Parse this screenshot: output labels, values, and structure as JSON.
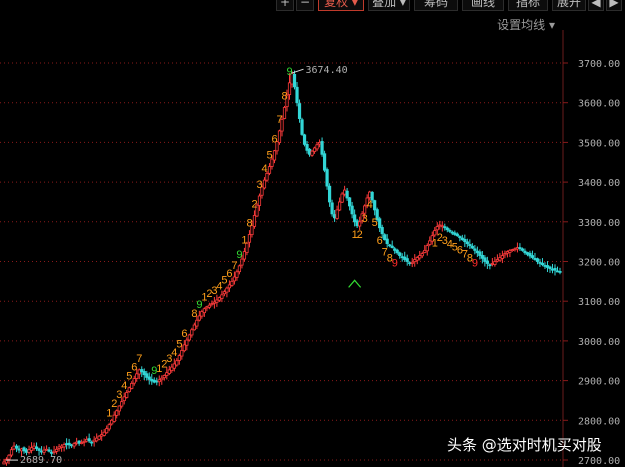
{
  "toolbar": {
    "buttons": [
      {
        "label": "+",
        "active": false
      },
      {
        "label": "−",
        "active": false
      },
      {
        "label": "复权 ▾",
        "active": true
      },
      {
        "label": "叠加 ▾",
        "active": false
      },
      {
        "label": "筹码",
        "active": false
      },
      {
        "label": "画线",
        "active": false
      },
      {
        "label": "指标",
        "active": false
      },
      {
        "label": "展开",
        "active": false
      },
      {
        "label": "◀",
        "active": false
      },
      {
        "label": "▶",
        "active": false
      }
    ]
  },
  "ma_settings_label": "设置均线 ▾",
  "watermark": "头条 @选对时机买对股",
  "colors": {
    "up": "#ff3b3b",
    "down": "#33d6d6",
    "grid": "#8a1a1a",
    "seq_orange": "#ff9f1a",
    "seq_green": "#33dd33",
    "seq_red": "#ff2a2a"
  },
  "chart_data": {
    "type": "candlestick",
    "ylim": [
      2700,
      3750
    ],
    "y_ticks": [
      "3700.00",
      "3600.00",
      "3500.00",
      "3400.00",
      "3300.00",
      "3200.00",
      "3100.00",
      "3000.00",
      "2900.00",
      "2800.00",
      "2700.00"
    ],
    "high_label": "3674.40",
    "low_label": "2689.70",
    "closes": [
      2695,
      2702,
      2712,
      2726,
      2735,
      2730,
      2725,
      2728,
      2723,
      2719,
      2726,
      2731,
      2735,
      2729,
      2724,
      2721,
      2725,
      2727,
      2722,
      2718,
      2722,
      2727,
      2733,
      2735,
      2739,
      2740,
      2738,
      2736,
      2741,
      2745,
      2742,
      2744,
      2747,
      2752,
      2748,
      2745,
      2750,
      2755,
      2760,
      2764,
      2770,
      2779,
      2789,
      2800,
      2813,
      2824,
      2836,
      2847,
      2859,
      2870,
      2882,
      2893,
      2905,
      2917,
      2927,
      2922,
      2915,
      2908,
      2903,
      2899,
      2896,
      2898,
      2902,
      2906,
      2913,
      2920,
      2927,
      2934,
      2942,
      2950,
      2963,
      2976,
      2990,
      3002,
      3015,
      3028,
      3040,
      3052,
      3063,
      3074,
      3081,
      3086,
      3090,
      3094,
      3098,
      3103,
      3109,
      3116,
      3124,
      3133,
      3141,
      3150,
      3161,
      3174,
      3189,
      3206,
      3225,
      3246,
      3268,
      3291,
      3316,
      3342,
      3365,
      3388,
      3405,
      3422,
      3439,
      3458,
      3479,
      3502,
      3529,
      3558,
      3588,
      3619,
      3650,
      3674,
      3640,
      3600,
      3560,
      3520,
      3495,
      3480,
      3470,
      3478,
      3486,
      3494,
      3500,
      3470,
      3430,
      3390,
      3350,
      3320,
      3310,
      3330,
      3350,
      3370,
      3380,
      3360,
      3340,
      3320,
      3300,
      3290,
      3300,
      3320,
      3340,
      3360,
      3375,
      3355,
      3330,
      3305,
      3285,
      3270,
      3255,
      3245,
      3240,
      3235,
      3228,
      3222,
      3215,
      3210,
      3205,
      3200,
      3195,
      3198,
      3205,
      3210,
      3215,
      3220,
      3228,
      3240,
      3252,
      3265,
      3278,
      3288,
      3292,
      3290,
      3285,
      3280,
      3276,
      3272,
      3268,
      3265,
      3260,
      3255,
      3250,
      3245,
      3240,
      3234,
      3228,
      3222,
      3215,
      3208,
      3200,
      3195,
      3190,
      3195,
      3200,
      3205,
      3210,
      3215,
      3220,
      3225,
      3228,
      3230,
      3232,
      3235,
      3233,
      3228,
      3222,
      3218,
      3214,
      3210,
      3205,
      3200,
      3196,
      3192,
      3188,
      3185,
      3182,
      3180,
      3178,
      3176,
      3174
    ]
  },
  "td_marks": [
    {
      "t": "1",
      "i": 42,
      "color": "orange"
    },
    {
      "t": "2",
      "i": 44,
      "color": "orange"
    },
    {
      "t": "3",
      "i": 46,
      "color": "orange"
    },
    {
      "t": "4",
      "i": 48,
      "color": "orange"
    },
    {
      "t": "5",
      "i": 50,
      "color": "orange"
    },
    {
      "t": "6",
      "i": 52,
      "color": "orange"
    },
    {
      "t": "7",
      "i": 54,
      "color": "orange"
    },
    {
      "t": "9",
      "i": 60,
      "color": "green"
    },
    {
      "t": "1",
      "i": 62,
      "color": "orange"
    },
    {
      "t": "2",
      "i": 64,
      "color": "orange"
    },
    {
      "t": "3",
      "i": 66,
      "color": "orange"
    },
    {
      "t": "4",
      "i": 68,
      "color": "orange"
    },
    {
      "t": "5",
      "i": 70,
      "color": "orange"
    },
    {
      "t": "6",
      "i": 72,
      "color": "orange"
    },
    {
      "t": "8",
      "i": 76,
      "color": "orange"
    },
    {
      "t": "9",
      "i": 78,
      "color": "green"
    },
    {
      "t": "1",
      "i": 80,
      "color": "orange"
    },
    {
      "t": "2",
      "i": 82,
      "color": "orange"
    },
    {
      "t": "3",
      "i": 84,
      "color": "orange"
    },
    {
      "t": "4",
      "i": 86,
      "color": "orange"
    },
    {
      "t": "5",
      "i": 88,
      "color": "orange"
    },
    {
      "t": "6",
      "i": 90,
      "color": "orange"
    },
    {
      "t": "7",
      "i": 92,
      "color": "orange"
    },
    {
      "t": "9",
      "i": 94,
      "color": "green"
    },
    {
      "t": "1",
      "i": 96,
      "color": "orange"
    },
    {
      "t": "8",
      "i": 98,
      "color": "orange"
    },
    {
      "t": "2",
      "i": 100,
      "color": "orange"
    },
    {
      "t": "3",
      "i": 102,
      "color": "orange"
    },
    {
      "t": "4",
      "i": 104,
      "color": "orange"
    },
    {
      "t": "5",
      "i": 106,
      "color": "orange"
    },
    {
      "t": "6",
      "i": 108,
      "color": "orange"
    },
    {
      "t": "7",
      "i": 110,
      "color": "orange"
    },
    {
      "t": "8",
      "i": 112,
      "color": "orange"
    },
    {
      "t": "9",
      "i": 114,
      "color": "green"
    },
    {
      "t": "1",
      "i": 140,
      "color": "orange"
    },
    {
      "t": "2",
      "i": 142,
      "color": "orange"
    },
    {
      "t": "3",
      "i": 144,
      "color": "orange"
    },
    {
      "t": "4",
      "i": 146,
      "color": "orange"
    },
    {
      "t": "5",
      "i": 148,
      "color": "orange"
    },
    {
      "t": "6",
      "i": 150,
      "color": "orange"
    },
    {
      "t": "7",
      "i": 152,
      "color": "orange"
    },
    {
      "t": "8",
      "i": 154,
      "color": "orange"
    },
    {
      "t": "9",
      "i": 156,
      "color": "red"
    },
    {
      "t": "1",
      "i": 172,
      "color": "orange"
    },
    {
      "t": "2",
      "i": 174,
      "color": "orange"
    },
    {
      "t": "3",
      "i": 176,
      "color": "orange"
    },
    {
      "t": "4",
      "i": 178,
      "color": "orange"
    },
    {
      "t": "5",
      "i": 180,
      "color": "orange"
    },
    {
      "t": "6",
      "i": 182,
      "color": "orange"
    },
    {
      "t": "7",
      "i": 184,
      "color": "orange"
    },
    {
      "t": "8",
      "i": 186,
      "color": "orange"
    },
    {
      "t": "9",
      "i": 188,
      "color": "red"
    }
  ]
}
